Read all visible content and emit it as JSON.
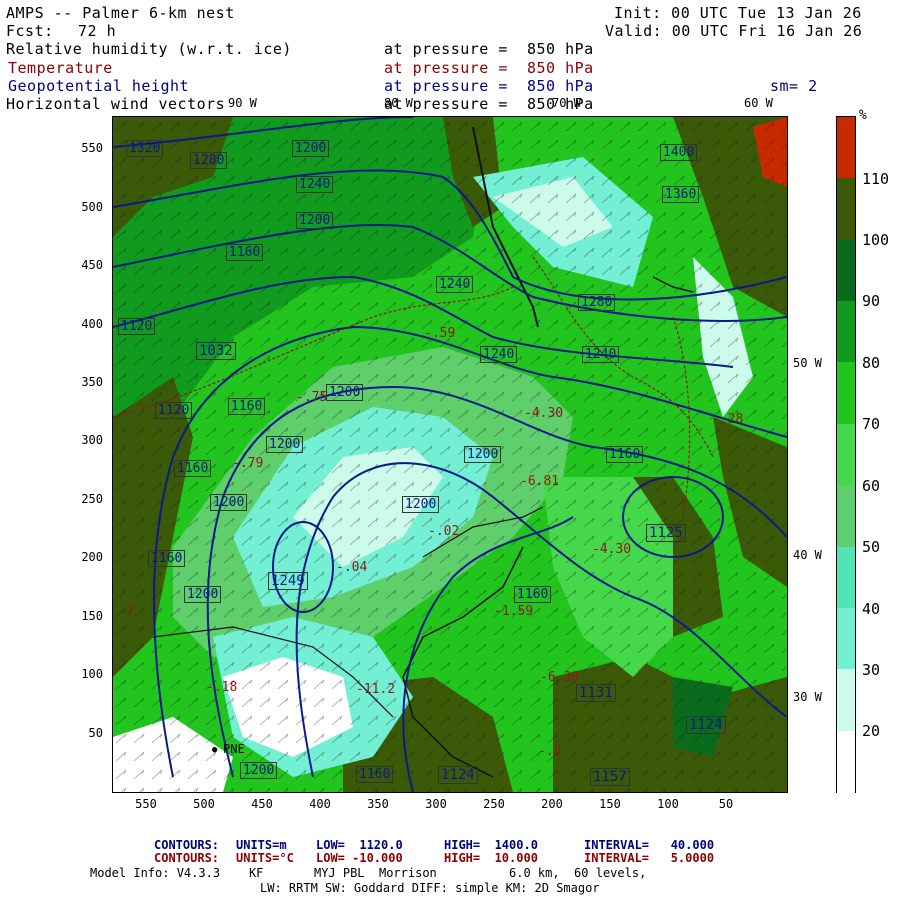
{
  "header": {
    "title": "AMPS -- Palmer 6-km nest",
    "fcst_label": "Fcst:",
    "fcst_value": "72 h",
    "init": "Init: 00 UTC Tue 13 Jan 26",
    "valid": "Valid: 00 UTC Fri 16 Jan 26",
    "fields": [
      {
        "name": "Relative humidity (w.r.t. ice)",
        "level": "at pressure =  850 hPa",
        "color": "#000000"
      },
      {
        "name": "Temperature",
        "level": "at pressure =  850 hPa",
        "color": "#8b0000"
      },
      {
        "name": "Geopotential height",
        "level": "at pressure =  850 hPa",
        "color": "#000080"
      },
      {
        "name": "Horizontal wind vectors",
        "level": "at pressure =  850 hPa",
        "color": "#000000"
      }
    ],
    "smoothing": "sm= 2"
  },
  "map": {
    "y_ticks": [
      "550",
      "500",
      "450",
      "400",
      "350",
      "300",
      "250",
      "200",
      "150",
      "100",
      "50"
    ],
    "x_ticks": [
      "550",
      "500",
      "450",
      "400",
      "350",
      "300",
      "250",
      "200",
      "150",
      "100",
      "50"
    ],
    "top_lon_labels": [
      "90 W",
      "80 W",
      "70 W",
      "60 W"
    ],
    "right_lon_labels": [
      "50 W",
      "40 W",
      "30 W"
    ],
    "station": "PNE",
    "height_contour_labels": [
      "1320",
      "1280",
      "1240",
      "1200",
      "1160",
      "1120",
      "1360",
      "1400",
      "1120",
      "1280",
      "1240",
      "1200",
      "1160",
      "1200",
      "1240",
      "1160",
      "1200",
      "1200",
      "1160",
      "1160",
      "1200",
      "1200",
      "1160",
      "1240",
      "1200",
      "1160",
      "1200"
    ],
    "extrema_labels": [
      {
        "kind": "L",
        "value": "1032"
      },
      {
        "kind": "H",
        "value": "1249"
      },
      {
        "kind": "L",
        "value": "1125"
      },
      {
        "kind": "H",
        "value": "1131"
      },
      {
        "kind": "L",
        "value": "1124"
      },
      {
        "kind": "L",
        "value": "1124"
      },
      {
        "kind": "H",
        "value": "1157"
      }
    ],
    "temperature_labels": [
      "-4.30",
      "-4.30",
      "-6.81",
      "-6.30",
      "-1.59",
      "-.59",
      "-.75",
      "-.79",
      "-.04",
      "-.02",
      "-11.2",
      "-.28",
      "-.18",
      "-.8",
      "-7"
    ]
  },
  "colorbar": {
    "unit": "%",
    "labels": [
      "110",
      "100",
      "90",
      "80",
      "70",
      "60",
      "50",
      "40",
      "30",
      "20"
    ],
    "colors": [
      "#c82a00",
      "#3a5a08",
      "#0b6b1c",
      "#109a1e",
      "#22c41e",
      "#44d84a",
      "#5ecf6a",
      "#4fe3b6",
      "#73efd4",
      "#ccfbec",
      "#ffffff"
    ]
  },
  "footer": {
    "contour1_label": "CONTOURS:",
    "contour1_units": "UNITS=m",
    "contour1_low": "LOW=  1120.0",
    "contour1_high": "HIGH=  1400.0",
    "contour1_interval": "INTERVAL=   40.000",
    "contour2_label": "CONTOURS:",
    "contour2_units": "UNITS=°C",
    "contour2_low": "LOW= -10.000",
    "contour2_high": "HIGH=  10.000",
    "contour2_interval": "INTERVAL=   5.0000",
    "model_info": "Model Info: V4.3.3    KF       MYJ PBL  Morrison          6.0 km,  60 levels,",
    "model_info2": "LW: RRTM SW: Goddard DIFF: simple KM: 2D Smagor"
  }
}
